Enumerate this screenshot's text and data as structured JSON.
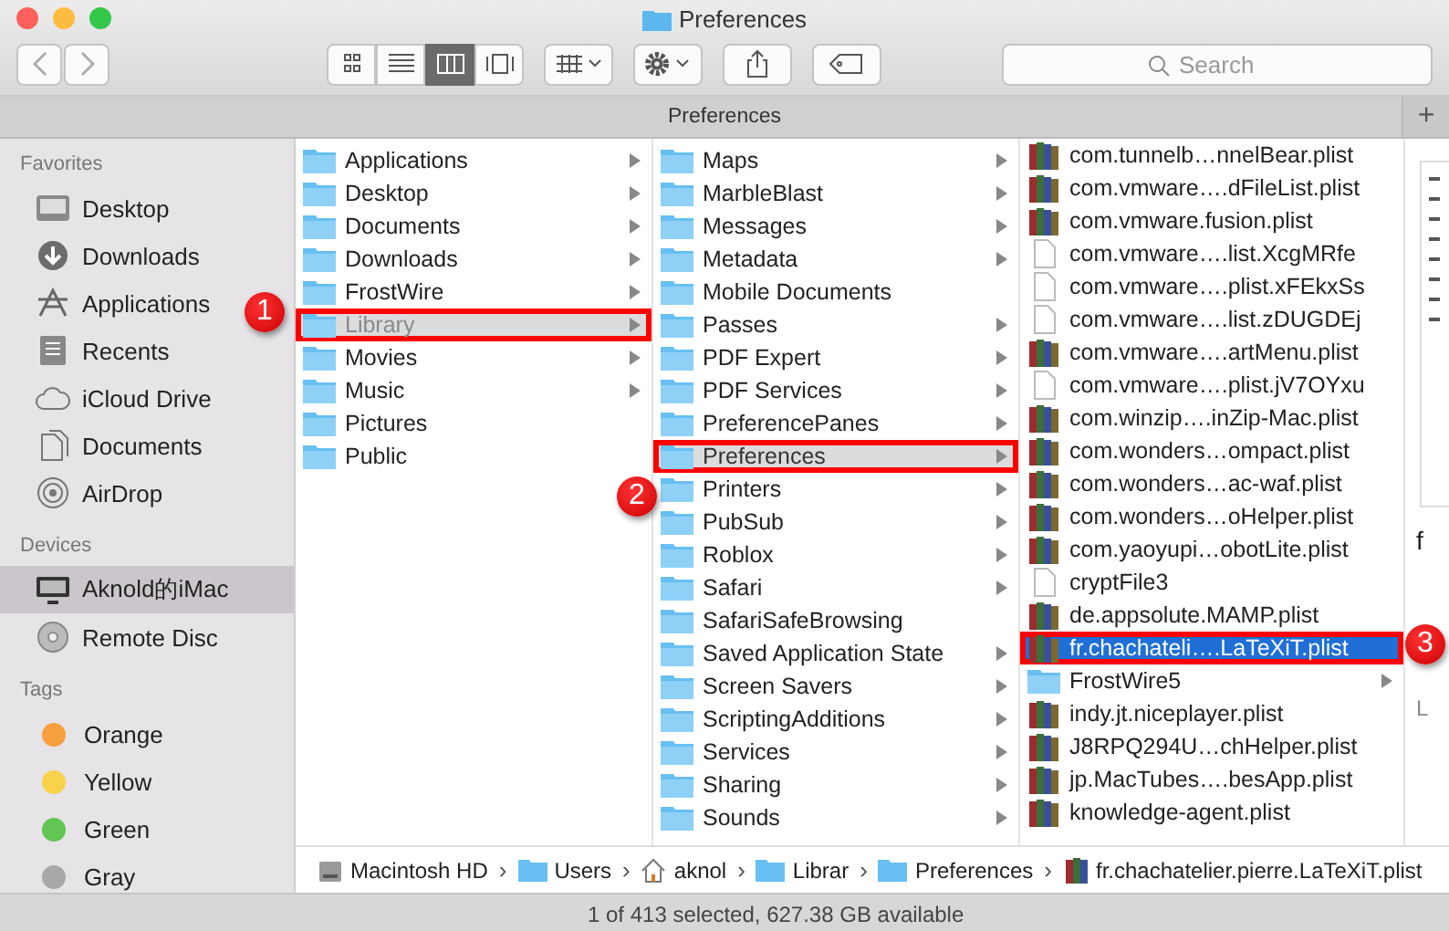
{
  "window": {
    "title": "Preferences"
  },
  "toolbar": {
    "view_modes": [
      {
        "selected": false
      },
      {
        "selected": false
      },
      {
        "selected": true
      },
      {
        "selected": false
      }
    ],
    "search": {
      "placeholder": "Search"
    }
  },
  "tab_bar": {
    "title": "Preferences",
    "add": "+"
  },
  "sidebar": {
    "sections": [
      {
        "heading": "Favorites",
        "items": [
          {
            "label": "Desktop",
            "selected": false
          },
          {
            "label": "Downloads",
            "selected": false
          },
          {
            "label": "Applications",
            "selected": false
          },
          {
            "label": "Recents",
            "selected": false
          },
          {
            "label": "iCloud Drive",
            "selected": false
          },
          {
            "label": "Documents",
            "selected": false
          },
          {
            "label": "AirDrop",
            "selected": false
          }
        ]
      },
      {
        "heading": "Devices",
        "items": [
          {
            "label": "Aknold的iMac",
            "selected": true
          },
          {
            "label": "Remote Disc",
            "selected": false
          }
        ]
      },
      {
        "heading": "Tags",
        "items": [
          {
            "label": "Orange",
            "selected": false,
            "color": "#f7a040"
          },
          {
            "label": "Yellow",
            "selected": false,
            "color": "#f8d24a"
          },
          {
            "label": "Green",
            "selected": false,
            "color": "#62c554"
          },
          {
            "label": "Gray",
            "selected": false,
            "color": "#a8a8a8"
          }
        ]
      }
    ]
  },
  "columns": [
    {
      "focused": false,
      "items": [
        {
          "label": "Applications",
          "kind": "folder",
          "selected": false,
          "has_children": true
        },
        {
          "label": "Desktop",
          "kind": "folder",
          "selected": false,
          "has_children": true
        },
        {
          "label": "Documents",
          "kind": "folder",
          "selected": false,
          "has_children": true
        },
        {
          "label": "Downloads",
          "kind": "folder",
          "selected": false,
          "has_children": true
        },
        {
          "label": "FrostWire",
          "kind": "folder",
          "selected": false,
          "has_children": true
        },
        {
          "label": "Library",
          "kind": "folder",
          "selected": true,
          "has_children": true,
          "callout": "1"
        },
        {
          "label": "Movies",
          "kind": "folder",
          "selected": false,
          "has_children": true
        },
        {
          "label": "Music",
          "kind": "folder",
          "selected": false,
          "has_children": true
        },
        {
          "label": "Pictures",
          "kind": "folder",
          "selected": false,
          "has_children": false
        },
        {
          "label": "Public",
          "kind": "folder",
          "selected": false,
          "has_children": false
        }
      ]
    },
    {
      "focused": false,
      "items": [
        {
          "label": "Maps",
          "kind": "folder",
          "selected": false,
          "has_children": true
        },
        {
          "label": "MarbleBlast",
          "kind": "folder",
          "selected": false,
          "has_children": true
        },
        {
          "label": "Messages",
          "kind": "folder",
          "selected": false,
          "has_children": true
        },
        {
          "label": "Metadata",
          "kind": "folder",
          "selected": false,
          "has_children": true
        },
        {
          "label": "Mobile Documents",
          "kind": "folder",
          "selected": false,
          "has_children": false
        },
        {
          "label": "Passes",
          "kind": "folder",
          "selected": false,
          "has_children": true
        },
        {
          "label": "PDF Expert",
          "kind": "folder",
          "selected": false,
          "has_children": true
        },
        {
          "label": "PDF Services",
          "kind": "folder",
          "selected": false,
          "has_children": true
        },
        {
          "label": "PreferencePanes",
          "kind": "folder",
          "selected": false,
          "has_children": true
        },
        {
          "label": "Preferences",
          "kind": "folder",
          "selected": true,
          "has_children": true,
          "callout": "2"
        },
        {
          "label": "Printers",
          "kind": "folder",
          "selected": false,
          "has_children": true
        },
        {
          "label": "PubSub",
          "kind": "folder",
          "selected": false,
          "has_children": true
        },
        {
          "label": "Roblox",
          "kind": "folder",
          "selected": false,
          "has_children": true
        },
        {
          "label": "Safari",
          "kind": "folder",
          "selected": false,
          "has_children": true
        },
        {
          "label": "SafariSafeBrowsing",
          "kind": "folder",
          "selected": false,
          "has_children": false
        },
        {
          "label": "Saved Application State",
          "kind": "folder",
          "selected": false,
          "has_children": true
        },
        {
          "label": "Screen Savers",
          "kind": "folder",
          "selected": false,
          "has_children": true
        },
        {
          "label": "ScriptingAdditions",
          "kind": "folder",
          "selected": false,
          "has_children": true
        },
        {
          "label": "Services",
          "kind": "folder",
          "selected": false,
          "has_children": true
        },
        {
          "label": "Sharing",
          "kind": "folder",
          "selected": false,
          "has_children": true
        },
        {
          "label": "Sounds",
          "kind": "folder",
          "selected": false,
          "has_children": true
        }
      ]
    },
    {
      "focused": true,
      "items": [
        {
          "label": "com.tunnelb…nnelBear.plist",
          "kind": "plist",
          "selected": false,
          "has_children": false
        },
        {
          "label": "com.vmware….dFileList.plist",
          "kind": "plist",
          "selected": false,
          "has_children": false
        },
        {
          "label": "com.vmware.fusion.plist",
          "kind": "plist",
          "selected": false,
          "has_children": false
        },
        {
          "label": "com.vmware….list.XcgMRfe",
          "kind": "file",
          "selected": false,
          "has_children": false
        },
        {
          "label": "com.vmware….plist.xFEkxSs",
          "kind": "file",
          "selected": false,
          "has_children": false
        },
        {
          "label": "com.vmware….list.zDUGDEj",
          "kind": "file",
          "selected": false,
          "has_children": false
        },
        {
          "label": "com.vmware….artMenu.plist",
          "kind": "plist",
          "selected": false,
          "has_children": false
        },
        {
          "label": "com.vmware….plist.jV7OYxu",
          "kind": "file",
          "selected": false,
          "has_children": false
        },
        {
          "label": "com.winzip….inZip-Mac.plist",
          "kind": "plist",
          "selected": false,
          "has_children": false
        },
        {
          "label": "com.wonders…ompact.plist",
          "kind": "plist",
          "selected": false,
          "has_children": false
        },
        {
          "label": "com.wonders…ac-waf.plist",
          "kind": "plist",
          "selected": false,
          "has_children": false
        },
        {
          "label": "com.wonders…oHelper.plist",
          "kind": "plist",
          "selected": false,
          "has_children": false
        },
        {
          "label": "com.yaoyupi…obotLite.plist",
          "kind": "plist",
          "selected": false,
          "has_children": false
        },
        {
          "label": "cryptFile3",
          "kind": "file",
          "selected": false,
          "has_children": false
        },
        {
          "label": "de.appsolute.MAMP.plist",
          "kind": "plist",
          "selected": false,
          "has_children": false
        },
        {
          "label": "fr.chachateli….LaTeXiT.plist",
          "kind": "plist",
          "selected": true,
          "has_children": false,
          "callout": "3"
        },
        {
          "label": "FrostWire5",
          "kind": "folder",
          "selected": false,
          "has_children": true
        },
        {
          "label": "indy.jt.niceplayer.plist",
          "kind": "plist",
          "selected": false,
          "has_children": false
        },
        {
          "label": "J8RPQ294U…chHelper.plist",
          "kind": "plist",
          "selected": false,
          "has_children": false
        },
        {
          "label": "jp.MacTubes….besApp.plist",
          "kind": "plist",
          "selected": false,
          "has_children": false
        },
        {
          "label": "knowledge-agent.plist",
          "kind": "plist",
          "selected": false,
          "has_children": false
        }
      ]
    }
  ],
  "preview": {
    "texts": [
      "f",
      "L"
    ]
  },
  "path_bar": {
    "separator": "›",
    "items": [
      {
        "label": "Macintosh HD",
        "kind": "disk"
      },
      {
        "label": "Users",
        "kind": "folder"
      },
      {
        "label": "aknol",
        "kind": "home"
      },
      {
        "label": "Librar",
        "kind": "folder"
      },
      {
        "label": "Preferences",
        "kind": "folder"
      },
      {
        "label": "fr.chachatelier.pierre.LaTeXiT.plist",
        "kind": "plist"
      }
    ]
  },
  "status_bar": "1 of 413 selected, 627.38 GB available"
}
